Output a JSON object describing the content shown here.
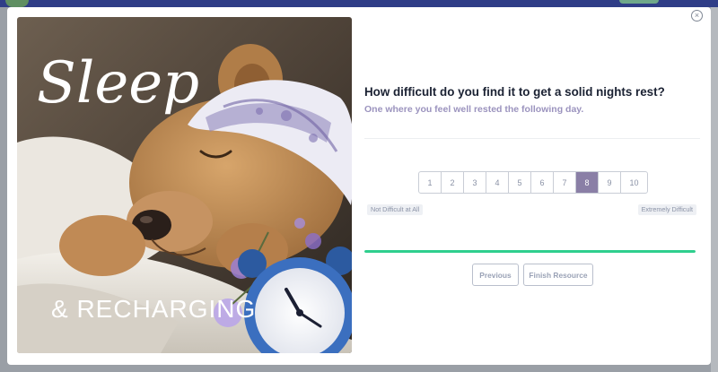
{
  "dialog": {
    "close_glyph": "×",
    "hero": {
      "title_text": "Sleep",
      "subtitle_text": "& RECHARGING"
    },
    "question": {
      "title": "How difficult do you find it to get a solid nights rest?",
      "subtitle": "One where you feel well rested the following day."
    },
    "scale": {
      "options": [
        "1",
        "2",
        "3",
        "4",
        "5",
        "6",
        "7",
        "8",
        "9",
        "10"
      ],
      "selected": "8",
      "min_label": "Not Difficult at All",
      "max_label": "Extremely Difficult"
    },
    "progress": {
      "fraction": 1.0,
      "color": "#2fcf8e"
    },
    "buttons": {
      "previous": "Previous",
      "finish": "Finish Resource"
    }
  },
  "colors": {
    "selected_option": "#8a7fa6",
    "subtitle_text": "#9b93be",
    "title_text": "#1b2233",
    "page_header": "#2f3d87"
  }
}
